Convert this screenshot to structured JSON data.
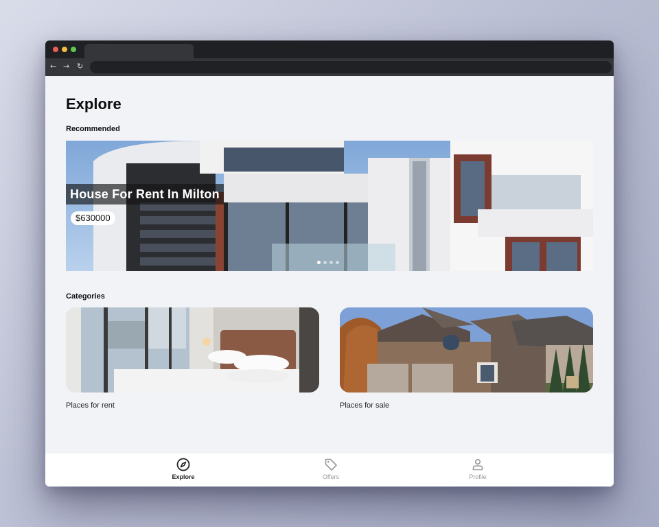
{
  "browser": {
    "back_icon": "arrow-left-icon",
    "forward_icon": "arrow-right-icon",
    "reload_icon": "reload-icon"
  },
  "page": {
    "title": "Explore"
  },
  "recommended": {
    "label": "Recommended",
    "listing": {
      "title": "House For Rent In Milton",
      "price": "$630000"
    },
    "carousel": {
      "count": 4,
      "active": 1
    }
  },
  "categories": {
    "label": "Categories",
    "items": [
      {
        "label": "Places for rent",
        "image": "bedroom-photo"
      },
      {
        "label": "Places for sale",
        "image": "house-exterior-photo"
      }
    ]
  },
  "bottom_nav": {
    "items": [
      {
        "label": "Explore",
        "icon": "compass-icon",
        "active": true
      },
      {
        "label": "Offers",
        "icon": "tag-icon",
        "active": false
      },
      {
        "label": "Profile",
        "icon": "user-icon",
        "active": false
      }
    ]
  },
  "colors": {
    "window_chrome": "#1f2023",
    "content_bg": "#f2f3f7",
    "active_nav": "#222222",
    "inactive_nav": "#999999"
  }
}
